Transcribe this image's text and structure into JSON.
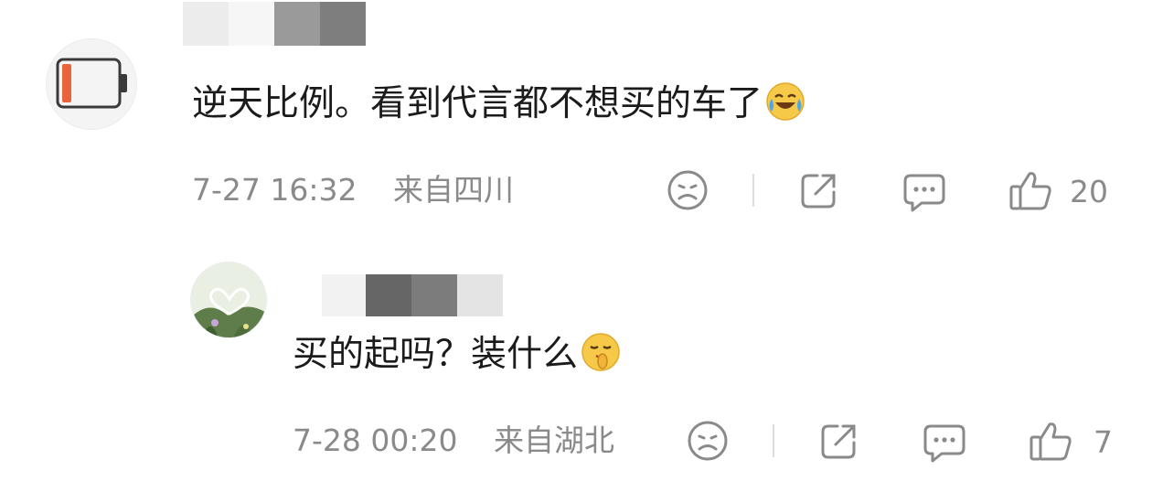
{
  "comment": {
    "text": "逆天比例。看到代言都不想买的车了",
    "emoji": "laughing-crying-emoji",
    "timestamp": "7-27 16:32",
    "location": "来自四川",
    "likes": "20",
    "avatar": "battery-low-icon"
  },
  "reply": {
    "text": "买的起吗？装什么",
    "emoji": "shush-emoji",
    "timestamp": "7-28 00:20",
    "location": "来自湖北",
    "likes": "7",
    "avatar": "heart-plant-avatar"
  },
  "colors": {
    "text": "#1b1b1b",
    "meta": "#8a8a8a",
    "battery": "#e8643a"
  }
}
